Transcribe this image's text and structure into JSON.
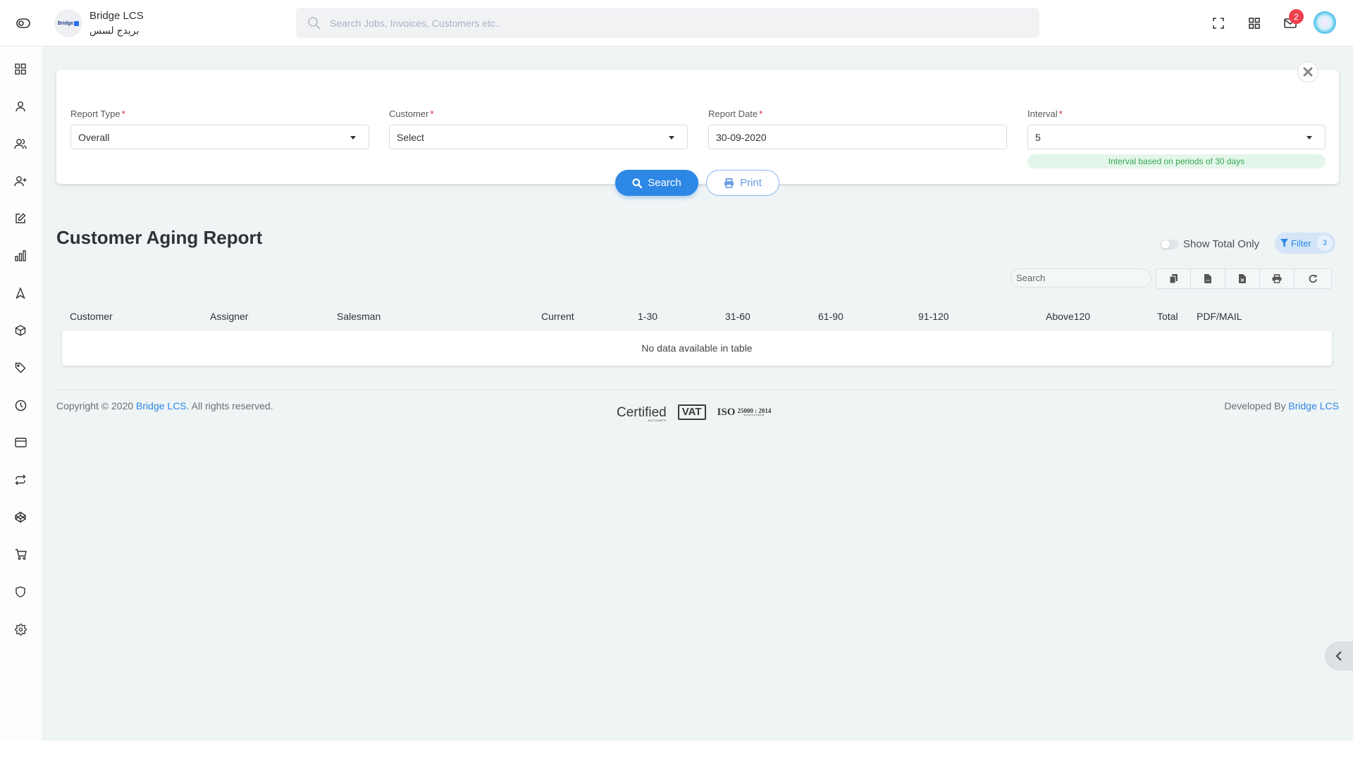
{
  "app": {
    "brand_name": "Bridge LCS",
    "brand_name_arabic": "بريدج لسس",
    "logo_text": "Bridge"
  },
  "header": {
    "search_placeholder": "Search Jobs, Invoices, Customers etc..",
    "notification_count": "2",
    "icons": [
      "sidebar-toggle-icon",
      "fullscreen-icon",
      "apps-grid-icon",
      "mail-icon",
      "user-avatar"
    ]
  },
  "sidebar": {
    "items": [
      {
        "icon": "dashboard-grid-icon"
      },
      {
        "icon": "user-icon"
      },
      {
        "icon": "users-icon"
      },
      {
        "icon": "user-add-icon"
      },
      {
        "icon": "edit-icon"
      },
      {
        "icon": "bar-chart-icon"
      },
      {
        "icon": "navigation-icon"
      },
      {
        "icon": "box-icon"
      },
      {
        "icon": "tag-icon"
      },
      {
        "icon": "clock-icon"
      },
      {
        "icon": "credit-card-icon"
      },
      {
        "icon": "repeat-icon"
      },
      {
        "icon": "codepen-icon"
      },
      {
        "icon": "cart-icon"
      },
      {
        "icon": "shield-icon"
      },
      {
        "icon": "settings-icon"
      }
    ]
  },
  "filters": {
    "report_type": {
      "label": "Report Type",
      "required": "*",
      "value": "Overall"
    },
    "customer": {
      "label": "Customer",
      "required": "*",
      "value": "Select"
    },
    "report_date": {
      "label": "Report Date",
      "required": "*",
      "value": "30-09-2020"
    },
    "interval": {
      "label": "Interval",
      "required": "*",
      "value": "5",
      "hint": "Interval based on periods of 30 days"
    },
    "search_label": "Search",
    "print_label": "Print"
  },
  "report": {
    "title": "Customer Aging Report",
    "show_total_only_label": "Show Total Only",
    "show_total_only": false,
    "filter_label": "Filter",
    "filter_count": "3",
    "table_search_placeholder": "Search",
    "tools": [
      "copy-icon",
      "csv-icon",
      "excel-icon",
      "print-icon",
      "refresh-icon"
    ],
    "columns": [
      "Customer",
      "Assigner",
      "Salesman",
      "Current",
      "1-30",
      "31-60",
      "61-90",
      "91-120",
      "Above120",
      "Total",
      "PDF/MAIL"
    ],
    "empty_message": "No data available in table"
  },
  "footer": {
    "copyright_prefix": "Copyright © 2020 ",
    "copyright_link": "Bridge LCS",
    "copyright_suffix": ". All rights reserved.",
    "cert_certified": "Certified",
    "cert_certified_sub": "ACCOUNTS",
    "cert_vat": "VAT",
    "cert_iso": "ISO",
    "cert_iso_num": "25000 : 2014",
    "cert_iso_sub": "REGISTERED",
    "developed_prefix": "Developed By ",
    "developed_link": "Bridge LCS"
  },
  "colors": {
    "accent": "#2d88e5",
    "badge": "#f0414e",
    "hint_bg": "#e4f6ea",
    "hint_text": "#34a853",
    "main_bg": "#eff4f4"
  }
}
